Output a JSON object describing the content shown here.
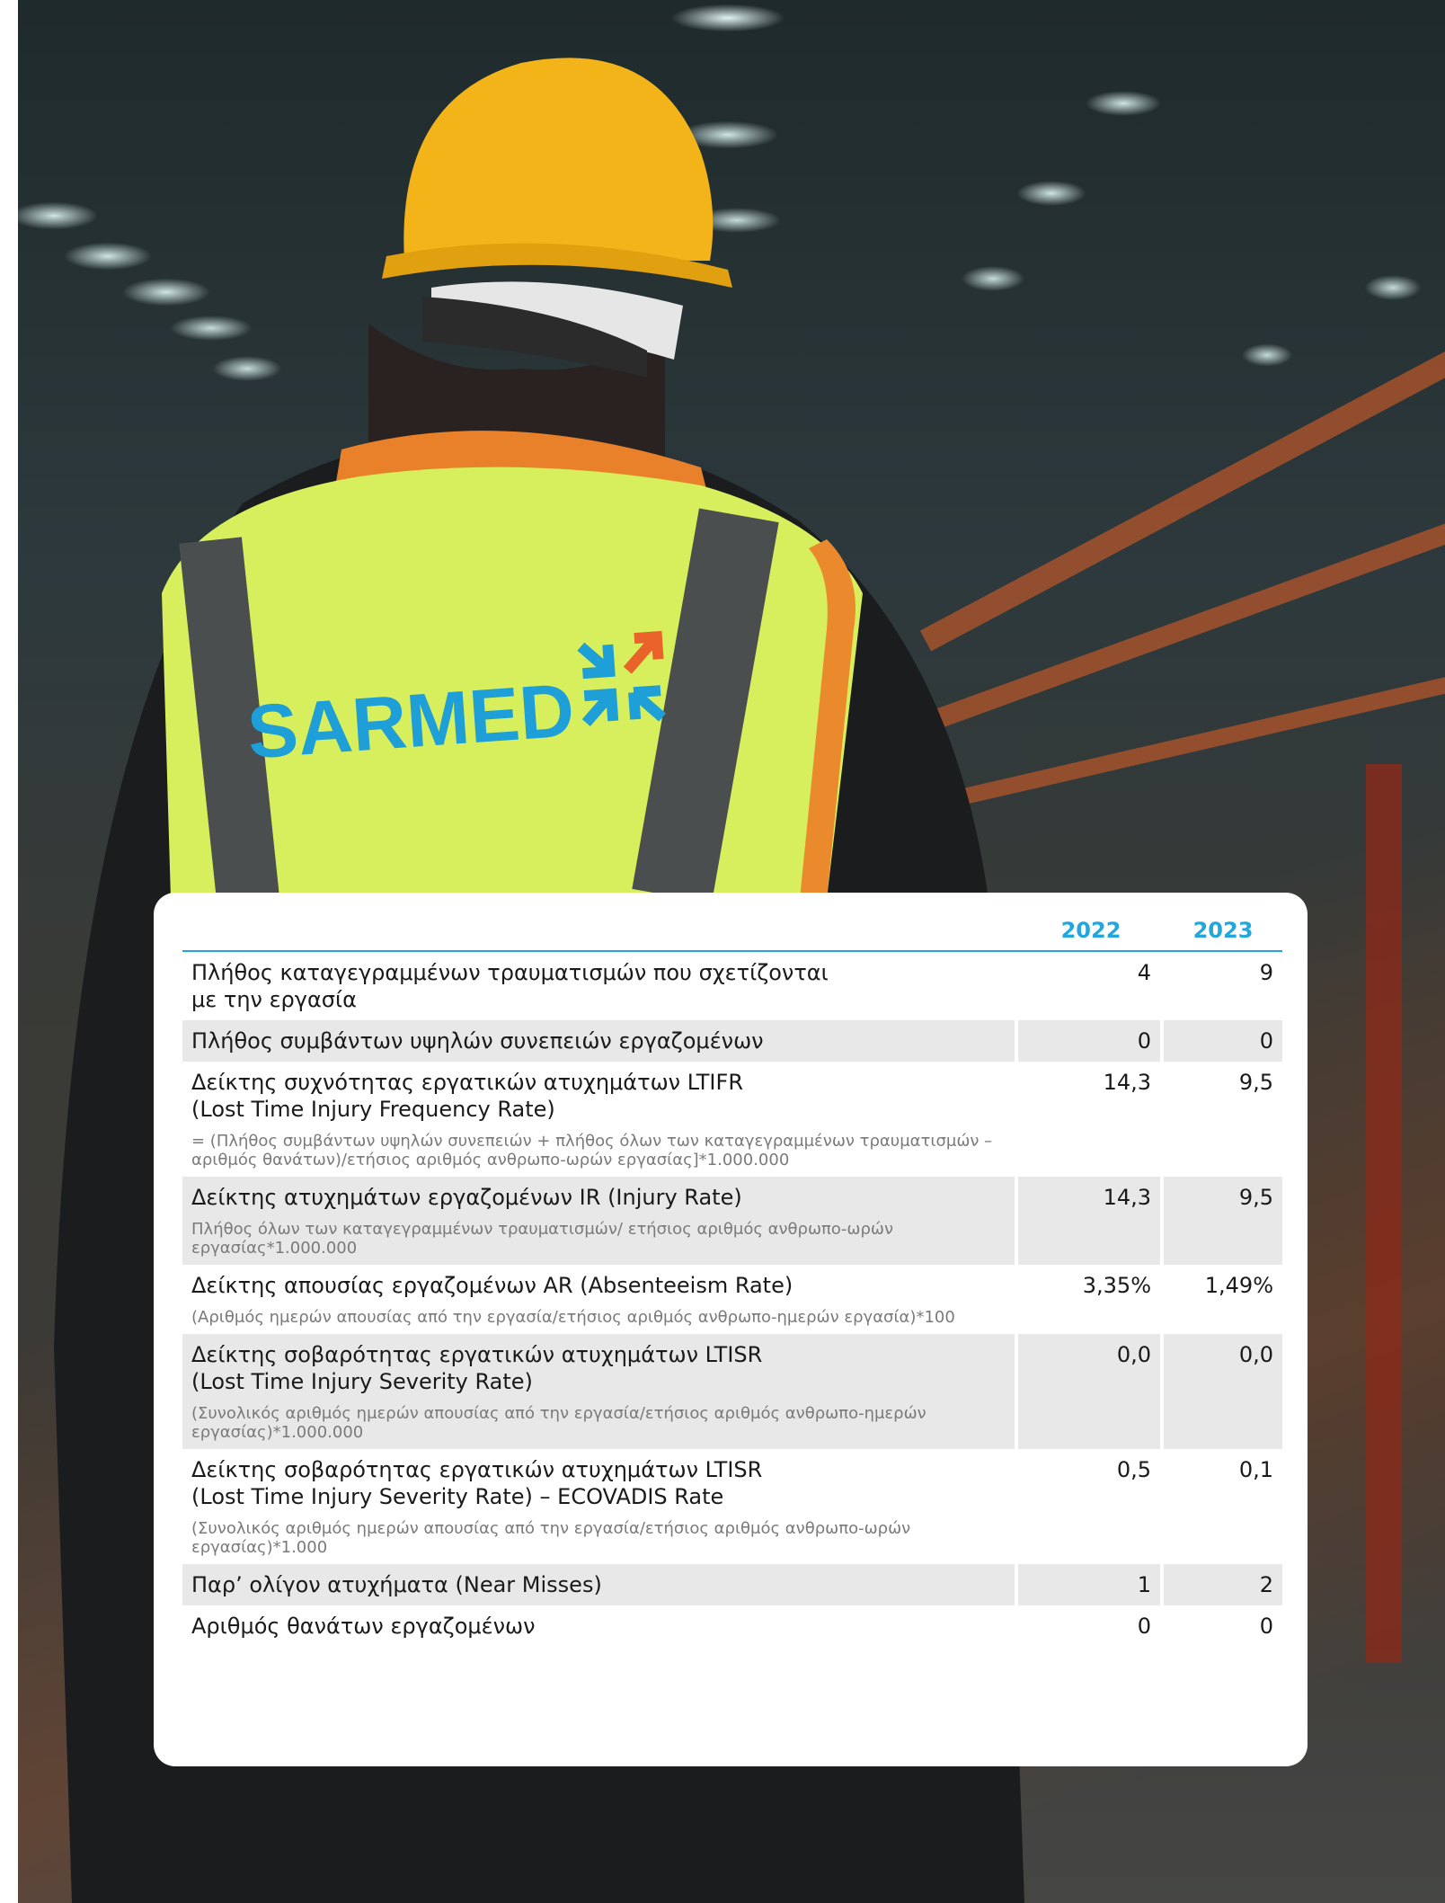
{
  "brand": {
    "logo_text": "SARMED",
    "colors": {
      "text_blue": "#1e9fd8",
      "arrow_orange": "#e8622a",
      "header_blue": "#22a6dc",
      "row_shade": "#e8e8e8",
      "vest": "#d6ef5a",
      "helmet": "#f2b418"
    }
  },
  "table": {
    "columns": [
      "2022",
      "2023"
    ],
    "rows": [
      {
        "label": "Πλήθος καταγεγραμμένων τραυματισμών που σχετίζονται με την εργασία",
        "label_lines": [
          "Πλήθος καταγεγραμμένων τραυματισμών που σχετίζονται",
          "με την εργασία"
        ],
        "note": "",
        "v2022": "4",
        "v2023": "9",
        "shaded": false
      },
      {
        "label_lines": [
          "Πλήθος συμβάντων υψηλών συνεπειών εργαζομένων"
        ],
        "note": "",
        "v2022": "0",
        "v2023": "0",
        "shaded": true
      },
      {
        "label_lines": [
          "Δείκτης συχνότητας εργατικών ατυχημάτων LTIFR",
          "(Lost Time Injury Frequency Rate)"
        ],
        "note": "= (Πλήθος συμβάντων υψηλών συνεπειών + πλήθος όλων των καταγεγραμμένων τραυματισμών – αριθμός θανάτων)/ετήσιος αριθμός ανθρωπο-ωρών εργασίας]*1.000.000",
        "v2022": "14,3",
        "v2023": "9,5",
        "shaded": false
      },
      {
        "label_lines": [
          "Δείκτης ατυχημάτων εργαζομένων IR (Injury Rate)"
        ],
        "note": "Πλήθος όλων των καταγεγραμμένων τραυματισμών/ ετήσιος αριθμός ανθρωπο-ωρών εργασίας*1.000.000",
        "v2022": "14,3",
        "v2023": "9,5",
        "shaded": true
      },
      {
        "label_lines": [
          "Δείκτης απουσίας εργαζομένων AR (Absenteeism Rate)"
        ],
        "note": "(Αριθμός ημερών απουσίας από την εργασία/ετήσιος αριθμός ανθρωπο-ημερών εργασία)*100",
        "v2022": "3,35%",
        "v2023": "1,49%",
        "shaded": false
      },
      {
        "label_lines": [
          "Δείκτης σοβαρότητας εργατικών ατυχημάτων LTISR",
          "(Lost Time Injury Severity Rate)"
        ],
        "note": "(Συνολικός αριθμός ημερών απουσίας από την εργασία/ετήσιος αριθμός ανθρωπο-ημερών εργασίας)*1.000.000",
        "v2022": "0,0",
        "v2023": "0,0",
        "shaded": true
      },
      {
        "label_lines": [
          "Δείκτης σοβαρότητας εργατικών ατυχημάτων LTISR",
          "(Lost Time Injury Severity Rate) – ECOVADIS Rate"
        ],
        "note": "(Συνολικός αριθμός ημερών απουσίας από την εργασία/ετήσιος αριθμός ανθρωπο-ωρών εργασίας)*1.000",
        "v2022": "0,5",
        "v2023": "0,1",
        "shaded": false
      },
      {
        "label_lines": [
          "Παρ’ ολίγον ατυχήματα (Near Misses)"
        ],
        "note": "",
        "v2022": "1",
        "v2023": "2",
        "shaded": true
      },
      {
        "label_lines": [
          "Αριθμός θανάτων εργαζομένων"
        ],
        "note": "",
        "v2022": "0",
        "v2023": "0",
        "shaded": false
      }
    ]
  }
}
